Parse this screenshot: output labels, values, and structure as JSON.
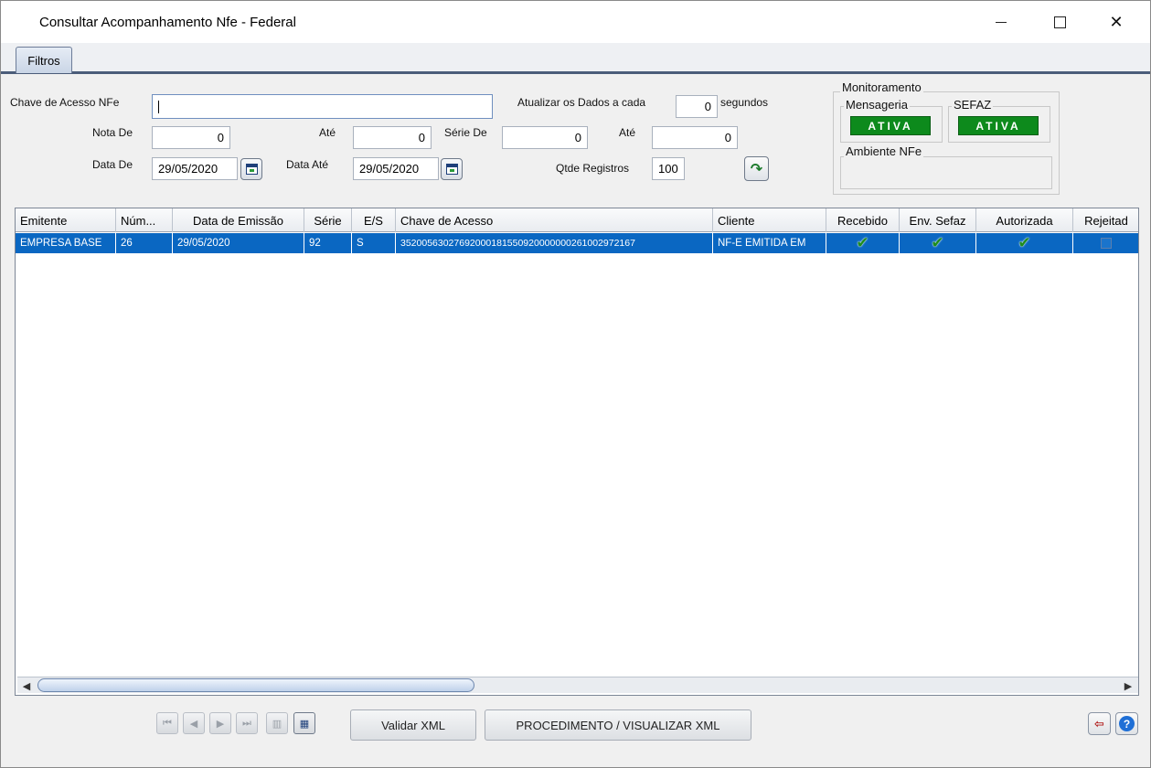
{
  "window": {
    "title": "Consultar Acompanhamento Nfe - Federal",
    "min_label": "—",
    "max_label": "",
    "close_label": "✕"
  },
  "tabs": [
    {
      "label": "Filtros"
    }
  ],
  "filters": {
    "chave_label": "Chave de Acesso NFe",
    "chave_value": "",
    "atualizar_label": "Atualizar os Dados a cada",
    "atualizar_value": "0",
    "segundos_label": "segundos",
    "nota_de_label": "Nota De",
    "nota_de_value": "0",
    "nota_ate_label": "Até",
    "nota_ate_value": "0",
    "serie_de_label": "Série De",
    "serie_de_value": "0",
    "serie_ate_label": "Até",
    "serie_ate_value": "0",
    "data_de_label": "Data De",
    "data_de_value": "29/05/2020",
    "data_ate_label": "Data Até",
    "data_ate_value": "29/05/2020",
    "qtde_label": "Qtde Registros",
    "qtde_value": "100"
  },
  "monitoring": {
    "title": "Monitoramento",
    "mensageria_label": "Mensageria",
    "mensageria_status": "ATIVA",
    "sefaz_label": "SEFAZ",
    "sefaz_status": "ATIVA",
    "ambiente_label": "Ambiente NFe",
    "status_color": "#0d8a1c"
  },
  "grid": {
    "columns": [
      "Emitente",
      "Núm...",
      "Data de Emissão",
      "Série",
      "E/S",
      "Chave de Acesso",
      "Cliente",
      "Recebido",
      "Env. Sefaz",
      "Autorizada",
      "Rejeitad"
    ],
    "rows": [
      {
        "emitente": "EMPRESA BASE",
        "numero": "26",
        "data_emissao": "29/05/2020",
        "serie": "92",
        "es": "S",
        "chave": "35200563027692000181550920000000261002972167",
        "cliente": "NF-E EMITIDA EM",
        "recebido": "✔",
        "env_sefaz": "✔",
        "autorizada": "✔"
      }
    ],
    "selection_color": "#0a67c2"
  },
  "toolbar": {
    "validar_label": "Validar XML",
    "procedimento_label": "PROCEDIMENTO / VISUALIZAR XML",
    "first_icon": "⏮",
    "prev_icon": "◀",
    "next_icon": "▶",
    "last_icon": "⏭",
    "exit_icon": "⇦",
    "help_icon": "?"
  }
}
